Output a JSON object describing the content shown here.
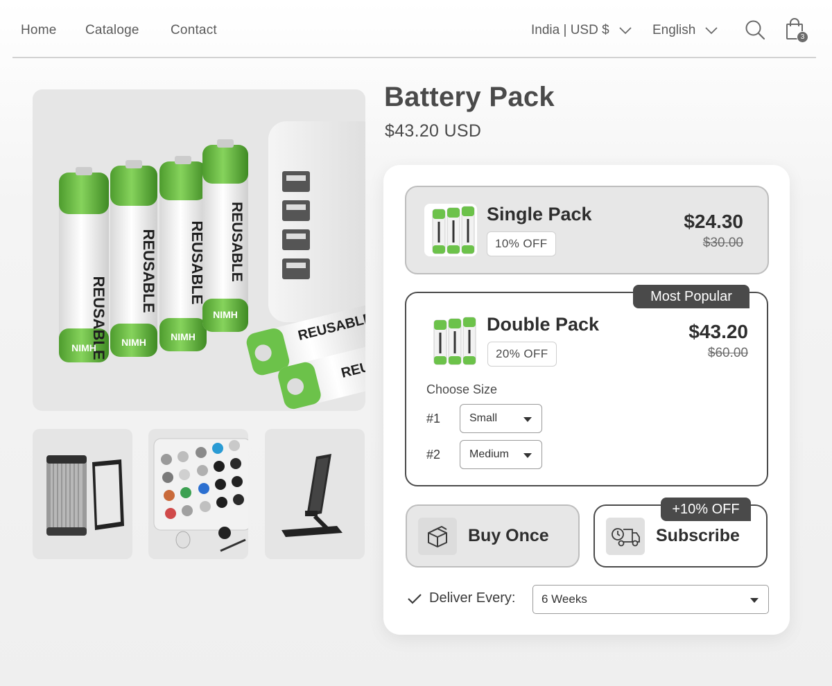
{
  "nav": {
    "home": "Home",
    "catalogue": "Cataloge",
    "contact": "Contact",
    "region": "India | USD $",
    "language": "English",
    "cart_count": "3"
  },
  "product": {
    "title": "Battery Pack",
    "price": "$43.20 USD"
  },
  "battery_label": "REUSABLE",
  "battery_type": "NIMH",
  "packs": [
    {
      "name": "Single Pack",
      "discount": "10% OFF",
      "price": "$24.30",
      "old_price": "$30.00",
      "selected": false
    },
    {
      "name": "Double Pack",
      "discount": "20% OFF",
      "price": "$43.20",
      "old_price": "$60.00",
      "selected": true,
      "ribbon": "Most Popular"
    }
  ],
  "size": {
    "label": "Choose Size",
    "rows": [
      {
        "num": "#1",
        "value": "Small"
      },
      {
        "num": "#2",
        "value": "Medium"
      }
    ]
  },
  "purchase": {
    "once": "Buy Once",
    "subscribe": "Subscribe",
    "subscribe_badge": "+10% OFF"
  },
  "delivery": {
    "label": "Deliver Every:",
    "value": "6 Weeks"
  },
  "colors": {
    "accent_dark": "#4a4a4a",
    "battery_green": "#6cc24a"
  },
  "icons": [
    "chevron-down-icon",
    "search-icon",
    "shopping-bag-icon",
    "box-icon",
    "delivery-truck-icon",
    "checkmark-icon",
    "caret-down-icon"
  ]
}
